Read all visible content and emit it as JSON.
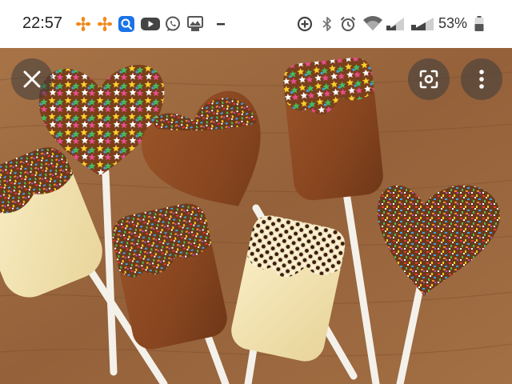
{
  "status_bar": {
    "time": "22:57",
    "battery_percent": "53%",
    "icons": [
      "fan-app-icon",
      "fan-app-icon",
      "search-app-icon",
      "youtube-icon",
      "whatsapp-icon",
      "photo-share-icon",
      "minus-icon",
      "data-saver-icon",
      "bluetooth-icon",
      "alarm-icon",
      "wifi-icon",
      "signal-icon",
      "signal-icon",
      "battery-icon"
    ],
    "accent_colors": {
      "fan": "#f08a1c",
      "search": "#1a73e8",
      "youtube": "#444444"
    }
  },
  "viewer": {
    "buttons": [
      "close-icon",
      "google-lens-icon",
      "more-vert-icon"
    ]
  }
}
